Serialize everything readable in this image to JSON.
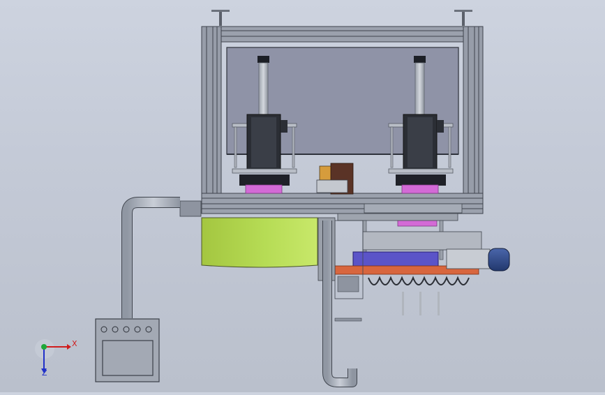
{
  "viewport": {
    "background_top": "#cdd3df",
    "background_bottom": "#bac0cc"
  },
  "model": {
    "frame_color": "#8a909c",
    "window_panel_color": "#8f93a7",
    "drum_color": "#b2d653",
    "magenta_part_color": "#d36ad6",
    "blue_rail_color": "#5b54c8",
    "orange_plate_color": "#d8663e",
    "motor_color": "#2f4a8c",
    "duct_color": "#a7adb9"
  },
  "triad": {
    "x_label": "X",
    "z_label": "Z",
    "x_color": "#d01c1c",
    "y_color": "#1fa83a",
    "z_color": "#2030c8"
  }
}
